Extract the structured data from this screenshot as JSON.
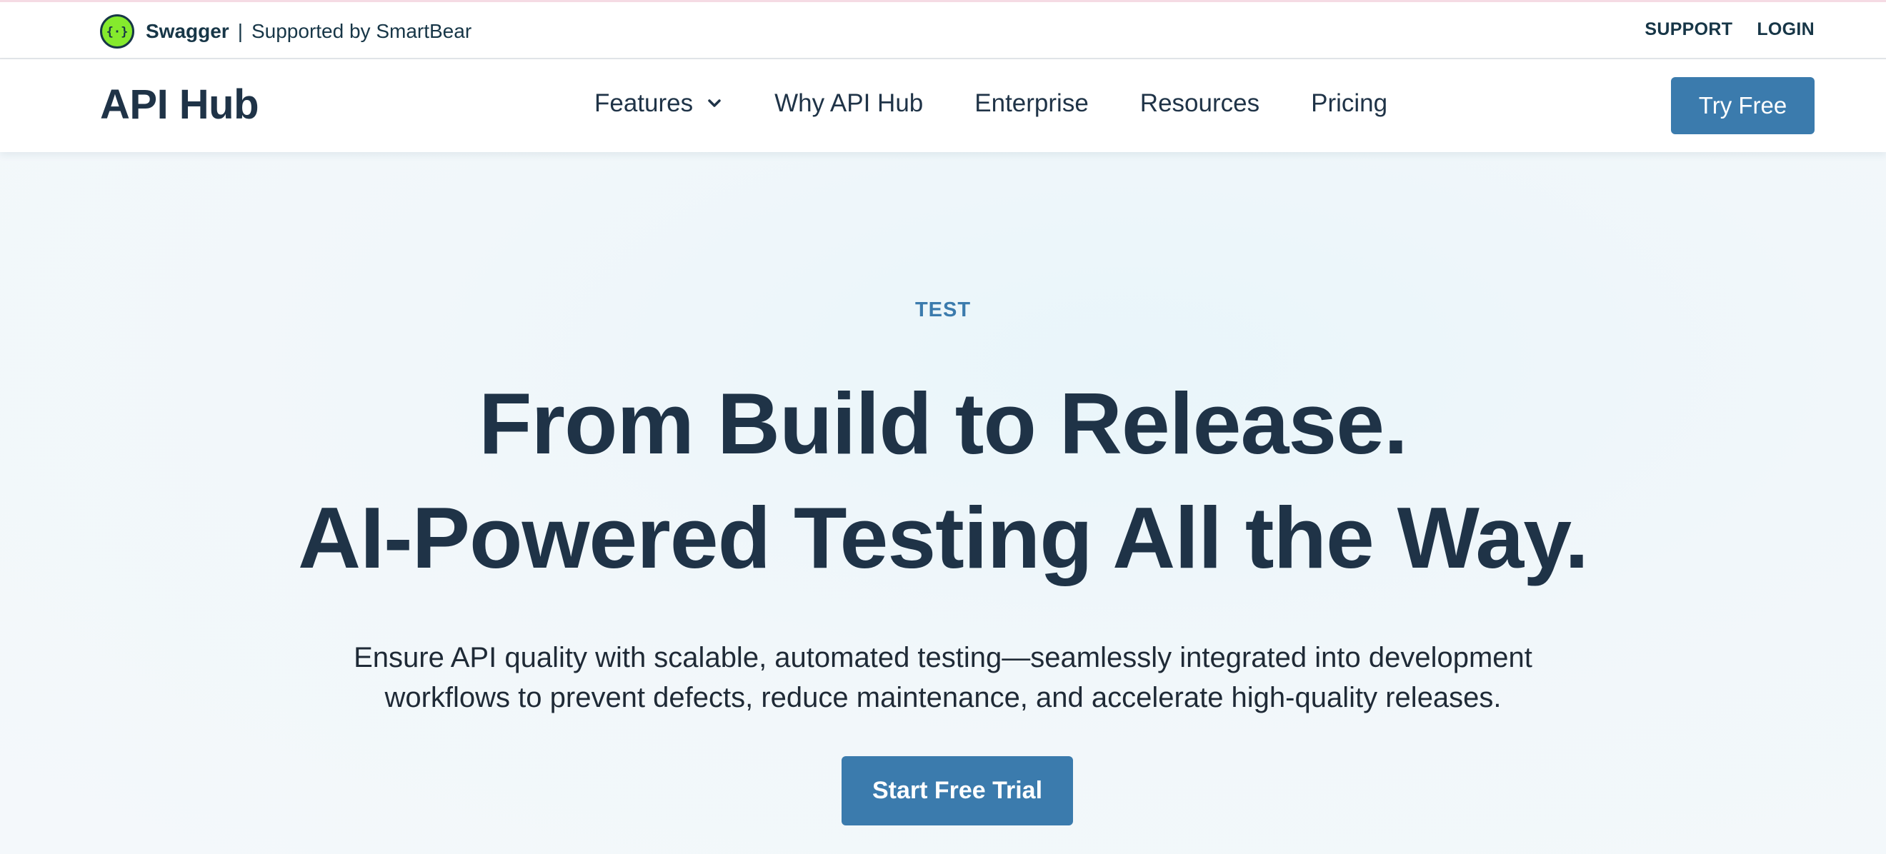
{
  "topbar": {
    "brand_name": "Swagger",
    "separator": "|",
    "supported_by": "Supported by SmartBear",
    "links": {
      "support": "SUPPORT",
      "login": "LOGIN"
    }
  },
  "navbar": {
    "logo": "API Hub",
    "items": {
      "features": "Features",
      "why": "Why API Hub",
      "enterprise": "Enterprise",
      "resources": "Resources",
      "pricing": "Pricing"
    },
    "try_free": "Try Free"
  },
  "hero": {
    "eyebrow": "TEST",
    "headline_line1": "From Build to Release.",
    "headline_line2": "AI-Powered Testing All the Way.",
    "subtext": "Ensure API quality with scalable, automated testing—seamlessly integrated into development workflows to prevent defects, reduce maintenance, and accelerate high-quality releases.",
    "cta": "Start Free Trial"
  },
  "colors": {
    "accent": "#3b7bad",
    "text_dark": "#1f3347",
    "swagger_green": "#85ea2d"
  },
  "icons": {
    "swagger_logo": "swagger-logo-icon",
    "features_chevron": "chevron-down-icon"
  }
}
